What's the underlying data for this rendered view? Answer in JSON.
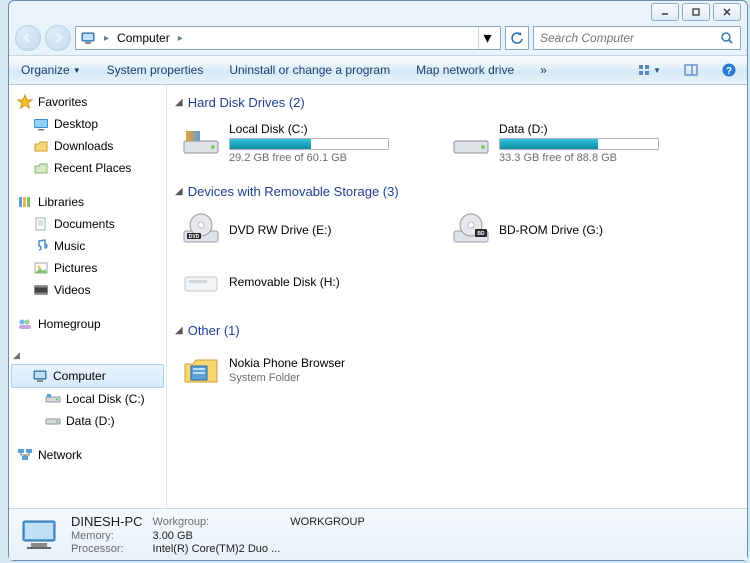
{
  "addressbar": {
    "location": "Computer"
  },
  "search": {
    "placeholder": "Search Computer"
  },
  "toolbar": {
    "organize": "Organize",
    "sysprops": "System properties",
    "uninstall": "Uninstall or change a program",
    "mapdrive": "Map network drive",
    "more": "»"
  },
  "sidebar": {
    "favorites": {
      "label": "Favorites",
      "items": [
        "Desktop",
        "Downloads",
        "Recent Places"
      ]
    },
    "libraries": {
      "label": "Libraries",
      "items": [
        "Documents",
        "Music",
        "Pictures",
        "Videos"
      ]
    },
    "homegroup": {
      "label": "Homegroup"
    },
    "computer": {
      "label": "Computer",
      "items": [
        "Local Disk (C:)",
        "Data (D:)"
      ]
    },
    "network": {
      "label": "Network"
    }
  },
  "sections": {
    "hdd": {
      "title": "Hard Disk Drives (2)",
      "drives": [
        {
          "name": "Local Disk (C:)",
          "free": "29.2 GB free of 60.1 GB",
          "pct": 51
        },
        {
          "name": "Data (D:)",
          "free": "33.3 GB free of 88.8 GB",
          "pct": 62
        }
      ]
    },
    "removable": {
      "title": "Devices with Removable Storage (3)",
      "drives": [
        {
          "name": "DVD RW Drive (E:)"
        },
        {
          "name": "BD-ROM Drive (G:)"
        },
        {
          "name": "Removable Disk (H:)"
        }
      ]
    },
    "other": {
      "title": "Other (1)",
      "items": [
        {
          "name": "Nokia Phone Browser",
          "sub": "System Folder"
        }
      ]
    }
  },
  "details": {
    "name": "DINESH-PC",
    "workgroup_label": "Workgroup:",
    "workgroup": "WORKGROUP",
    "memory_label": "Memory:",
    "memory": "3.00 GB",
    "processor_label": "Processor:",
    "processor": "Intel(R) Core(TM)2 Duo ..."
  }
}
